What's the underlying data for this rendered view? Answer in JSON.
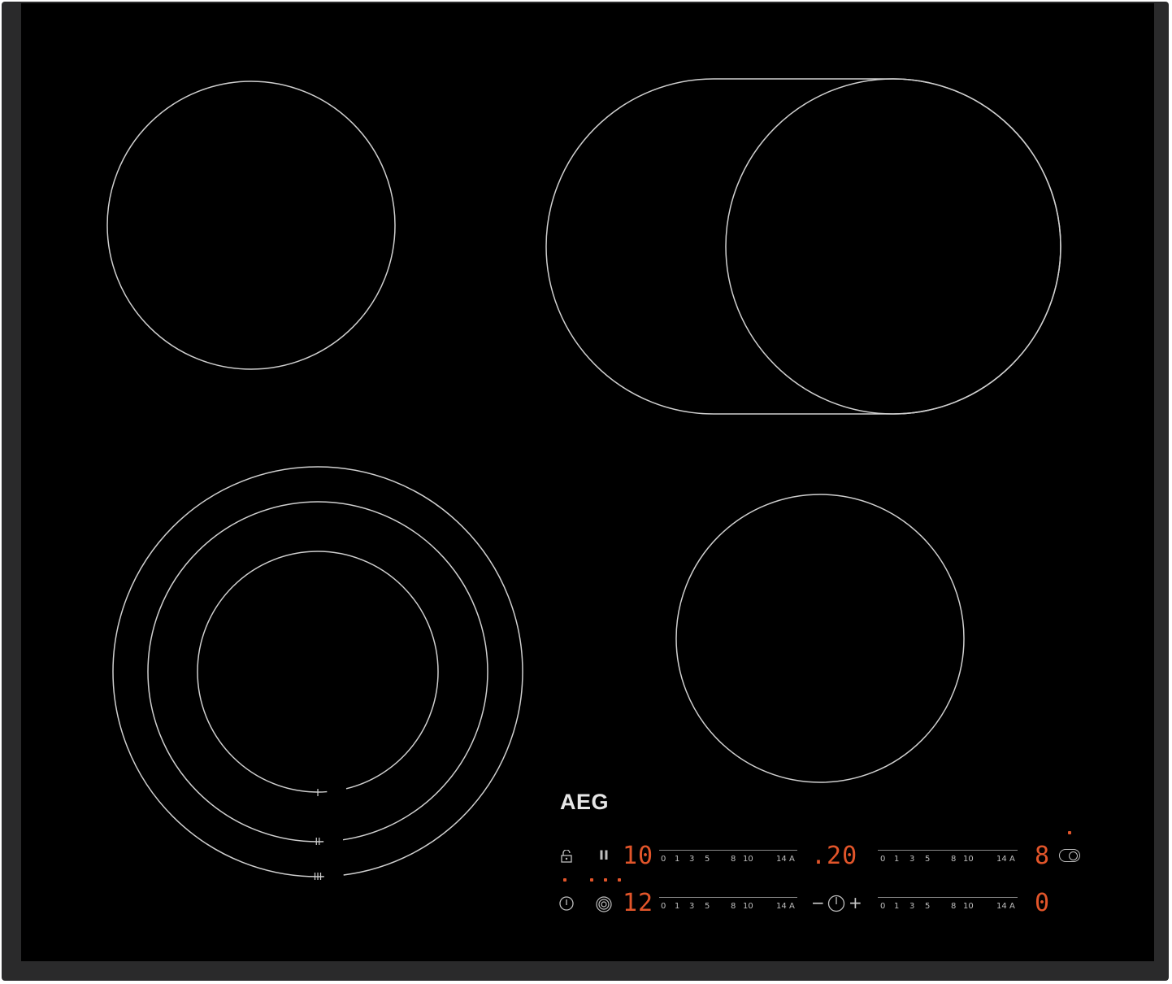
{
  "brand": "AEG",
  "colors": {
    "glass": "#000000",
    "frame": "#2a2a2b",
    "zone_outline": "#cfcfcf",
    "display_digits": "#e2552a",
    "icons": "#bfbfbf"
  },
  "zone_ring_marks": [
    "I",
    "II",
    "III"
  ],
  "scale_labels": [
    "0",
    "1",
    "3",
    "5",
    "8",
    "10",
    "14",
    "A"
  ],
  "controls": {
    "lock_icon": "lock-icon",
    "pause_label": "II",
    "power_icon": "power-icon",
    "ring_select_icon": "ring-select-icon",
    "bridge_icon": "bridge-icon"
  },
  "displays": {
    "front_left_level": "10",
    "rear_left_level": "12",
    "timer": ".20",
    "front_right_level": "8",
    "rear_right_level": "0"
  },
  "timer_controls": {
    "minus": "−",
    "plus": "+"
  }
}
